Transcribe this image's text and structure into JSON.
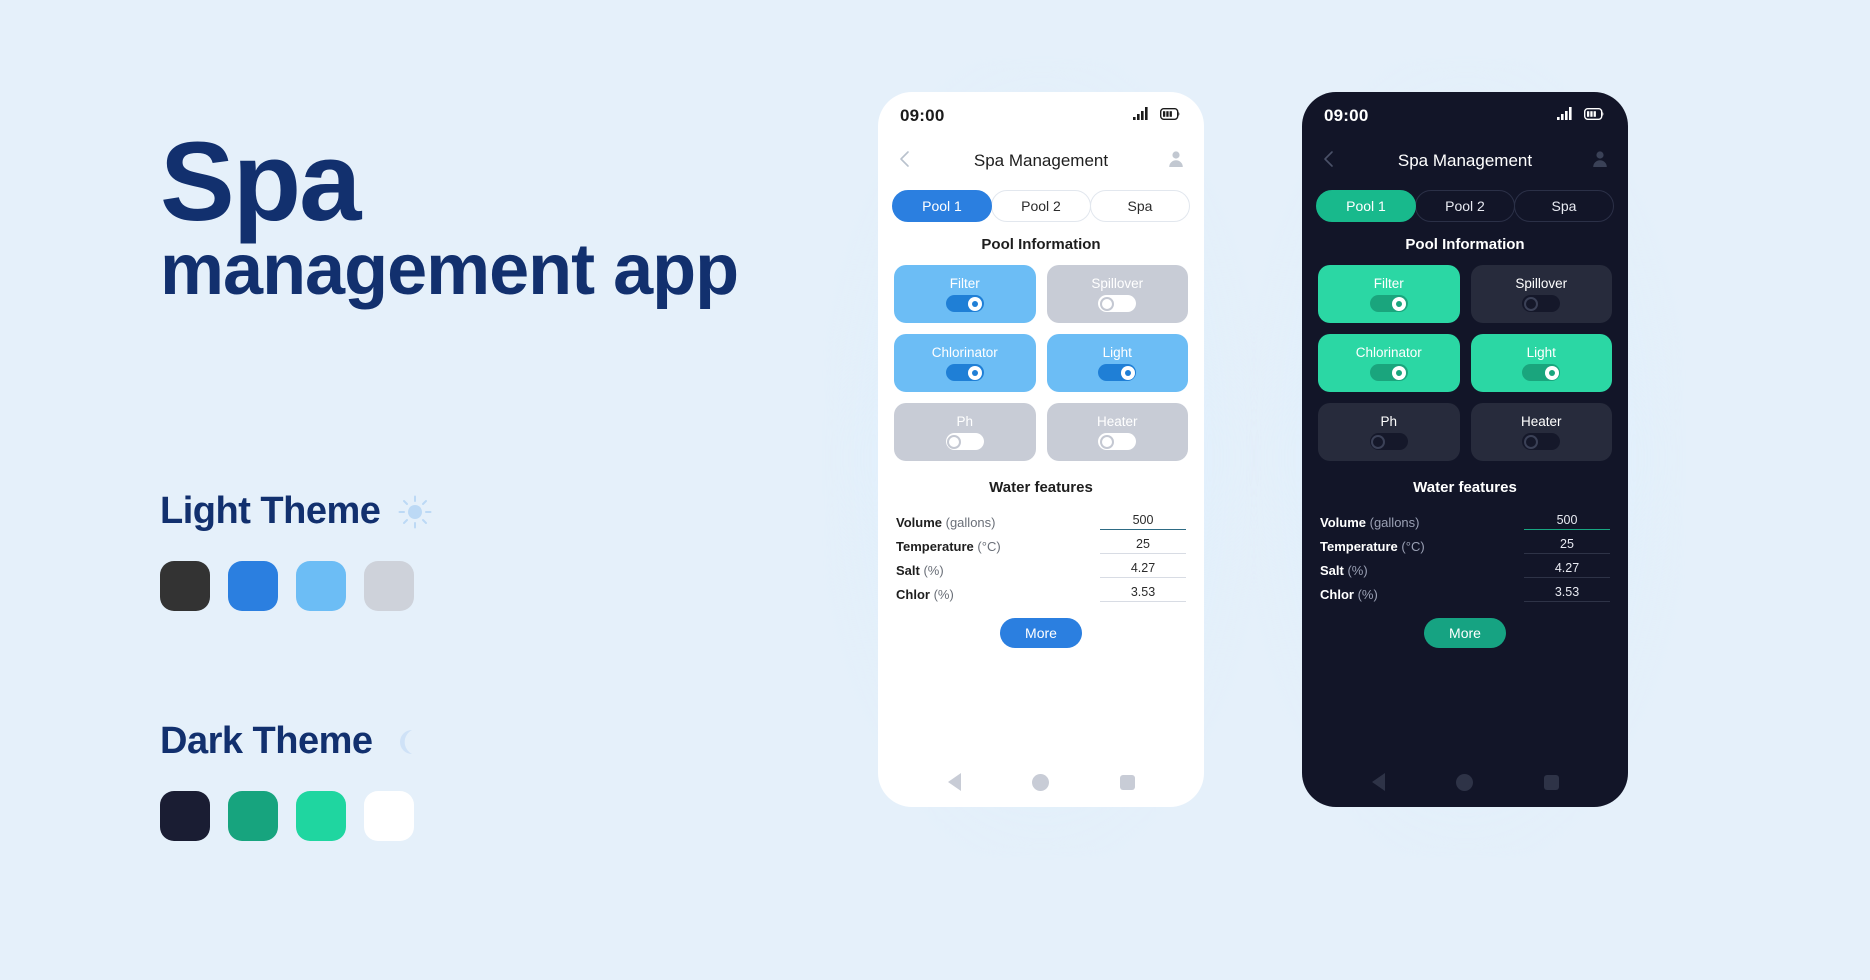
{
  "hero": {
    "title_line1": "Spa",
    "title_line2": "management app",
    "title_color": "#12306e"
  },
  "themes": {
    "light": {
      "label": "Light Theme",
      "icon": "sun-icon",
      "swatches": [
        "#333333",
        "#2b7fe0",
        "#6cbdf5",
        "#ced2da"
      ]
    },
    "dark": {
      "label": "Dark Theme",
      "icon": "moon-icon",
      "swatches": [
        "#1a1d33",
        "#17a47e",
        "#1fd6a0",
        "#ffffff"
      ]
    }
  },
  "phone": {
    "status_bar": {
      "time": "09:00",
      "signal_icon": "signal-bars-icon",
      "battery_icon": "battery-icon"
    },
    "header": {
      "back_icon": "back-chevron-icon",
      "title": "Spa Management",
      "avatar_icon": "user-avatar-icon"
    },
    "tabs": [
      {
        "label": "Pool 1",
        "active": true
      },
      {
        "label": "Pool 2",
        "active": false
      },
      {
        "label": "Spa",
        "active": false
      }
    ],
    "section_title": "Pool Information",
    "toggles": [
      {
        "label": "Filter",
        "on": true
      },
      {
        "label": "Spillover",
        "on": false
      },
      {
        "label": "Chlorinator",
        "on": true
      },
      {
        "label": "Light",
        "on": true
      },
      {
        "label": "Ph",
        "on": false
      },
      {
        "label": "Heater",
        "on": false
      }
    ],
    "water_title": "Water features",
    "fields": [
      {
        "name": "Volume",
        "unit": "(gallons)",
        "value": "500",
        "active": true
      },
      {
        "name": "Temperature",
        "unit": "(°C)",
        "value": "25",
        "active": false
      },
      {
        "name": "Salt",
        "unit": "(%)",
        "value": "4.27",
        "active": false
      },
      {
        "name": "Chlor",
        "unit": "(%)",
        "value": "3.53",
        "active": false
      }
    ],
    "more_button": "More",
    "nav": {
      "back_icon": "nav-back-triangle-icon",
      "home_icon": "nav-home-circle-icon",
      "recents_icon": "nav-recents-square-icon"
    }
  },
  "accents": {
    "light_primary": "#2b7fe0",
    "light_card_on": "#6cbdf5",
    "light_card_off": "#c8ccd6",
    "dark_primary": "#16a382",
    "dark_card_on": "#2bd7a4",
    "dark_card_off": "#272b3c",
    "page_bg": "#e5f0fa"
  }
}
